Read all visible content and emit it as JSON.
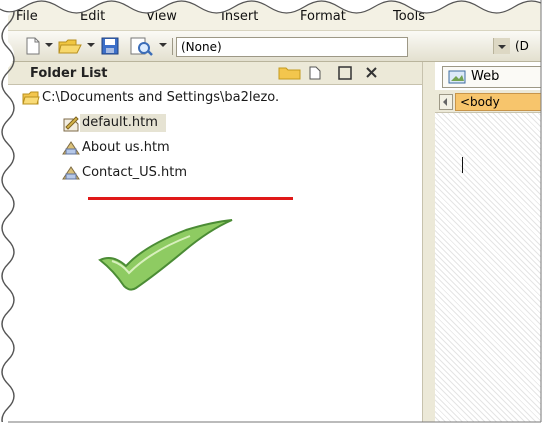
{
  "menu": {
    "items": [
      "File",
      "Edit",
      "View",
      "Insert",
      "Format",
      "Tools"
    ]
  },
  "toolbar": {
    "style_combo_value": "(None)",
    "second_combo_value": "(D"
  },
  "folder_list": {
    "title": "Folder List",
    "root": "C:\\Documents and Settings\\ba2lezo.",
    "files": [
      {
        "name": "default.htm",
        "icon": "edit-document-icon",
        "selected": true
      },
      {
        "name": "About us.htm",
        "icon": "html-file-icon",
        "selected": false
      },
      {
        "name": "Contact_US.htm",
        "icon": "html-file-icon",
        "selected": false
      }
    ]
  },
  "editor": {
    "tab_label": "Web",
    "tag_label": "<body"
  },
  "colors": {
    "underline": "#e01818",
    "checkmark": "#8ecb62",
    "tag_highlight": "#f7c56c"
  }
}
